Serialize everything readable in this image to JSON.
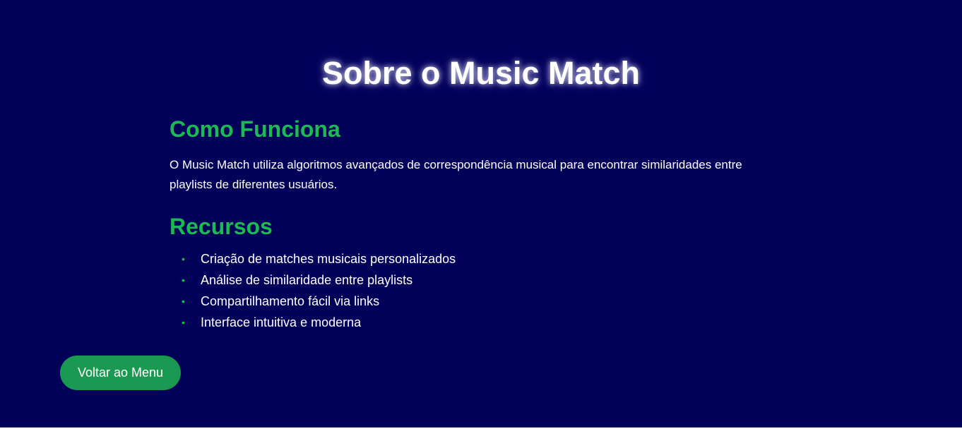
{
  "page": {
    "title": "Sobre o Music Match",
    "background_color": "#02015a",
    "accent_color": "#1db954",
    "button_color": "#1a9953"
  },
  "how_it_works": {
    "heading": "Como Funciona",
    "description": "O Music Match utiliza algoritmos avançados de correspondência musical para encontrar similaridades entre playlists de diferentes usuários."
  },
  "resources": {
    "heading": "Recursos",
    "bullet_glyph": "•",
    "items": [
      "Criação de matches musicais personalizados",
      "Análise de similaridade entre playlists",
      "Compartilhamento fácil via links",
      "Interface intuitiva e moderna"
    ]
  },
  "back_button": {
    "label": "Voltar ao Menu"
  }
}
